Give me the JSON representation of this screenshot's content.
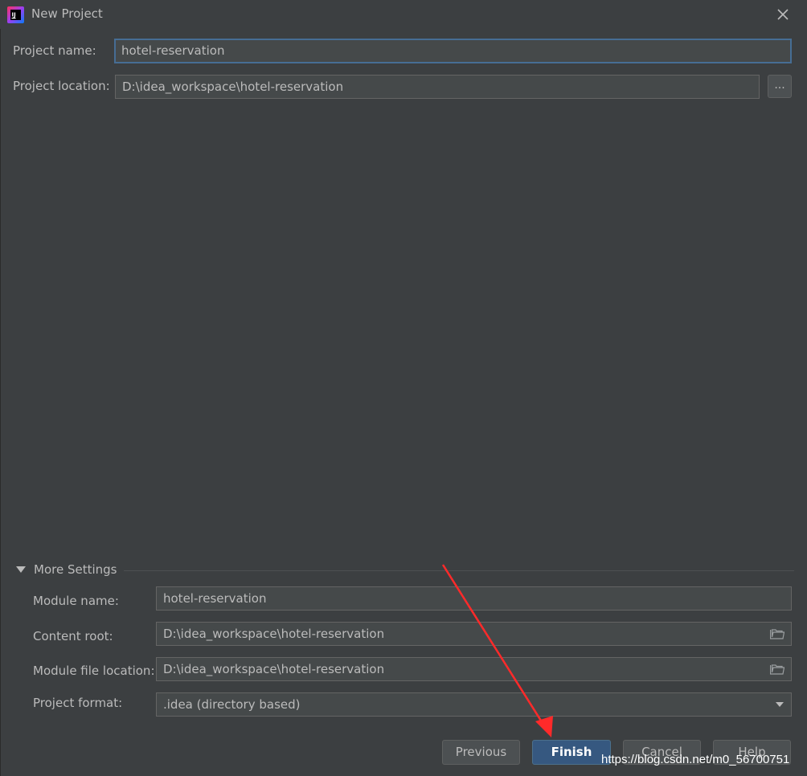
{
  "window": {
    "title": "New Project",
    "app_icon": "intellij-idea-icon",
    "close_icon": "close-icon"
  },
  "project": {
    "name_label": "Project name:",
    "name_value": "hotel-reservation",
    "location_label": "Project location:",
    "location_value": "D:\\idea_workspace\\hotel-reservation",
    "browse_label": "..."
  },
  "more_settings": {
    "header": "More Settings",
    "expanded": true,
    "module_name_label": "Module name:",
    "module_name_value": "hotel-reservation",
    "content_root_label": "Content root:",
    "content_root_value": "D:\\idea_workspace\\hotel-reservation",
    "module_file_label": "Module file location:",
    "module_file_value": "D:\\idea_workspace\\hotel-reservation",
    "format_label": "Project format:",
    "format_value": ".idea (directory based)"
  },
  "buttons": {
    "previous": "Previous",
    "finish": "Finish",
    "cancel": "Cancel",
    "help": "Help"
  },
  "watermark": "https://blog.csdn.net/m0_56700751",
  "colors": {
    "background": "#3c3f41",
    "field_bg": "#45494a",
    "focus_border": "#466d94",
    "primary_button": "#365880",
    "annotation_arrow": "#ff2a2a"
  }
}
